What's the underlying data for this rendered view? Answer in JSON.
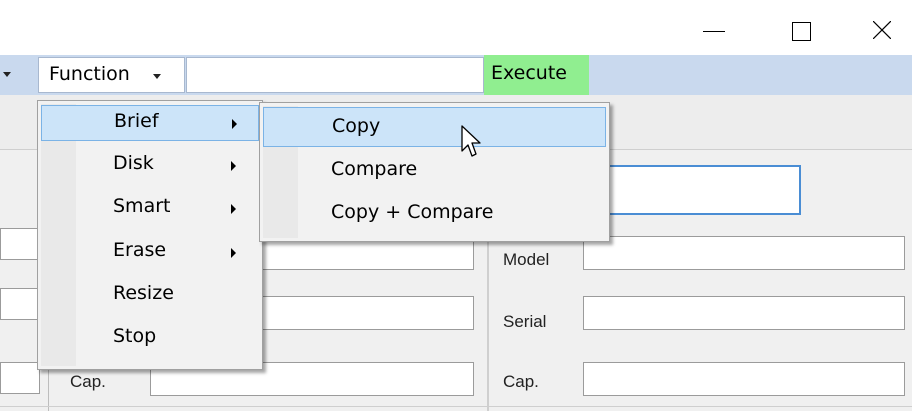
{
  "window": {
    "controls": {
      "minimize": "minimize-icon",
      "maximize": "maximize-icon",
      "close": "close-icon"
    }
  },
  "toolbar": {
    "function_label": "Function",
    "combo_value": "",
    "execute_label": "Execute",
    "execute_color": "#90ee90"
  },
  "function_menu": {
    "items": [
      {
        "label": "Brief",
        "has_submenu": true,
        "highlighted": true
      },
      {
        "label": "Disk",
        "has_submenu": true
      },
      {
        "label": "Smart",
        "has_submenu": true
      },
      {
        "label": "Erase",
        "has_submenu": true
      },
      {
        "label": "Resize",
        "has_submenu": false
      },
      {
        "label": "Stop",
        "has_submenu": false
      }
    ]
  },
  "brief_submenu": {
    "items": [
      {
        "label": "Copy",
        "highlighted": true
      },
      {
        "label": "Compare"
      },
      {
        "label": "Copy + Compare"
      }
    ]
  },
  "left_panel": {
    "cap_label": "Cap."
  },
  "right_panel": {
    "model_label": "Model",
    "serial_label": "Serial",
    "cap_label": "Cap."
  },
  "colors": {
    "highlight": "#cce4f9",
    "toolbar": "#c9d9ee"
  }
}
